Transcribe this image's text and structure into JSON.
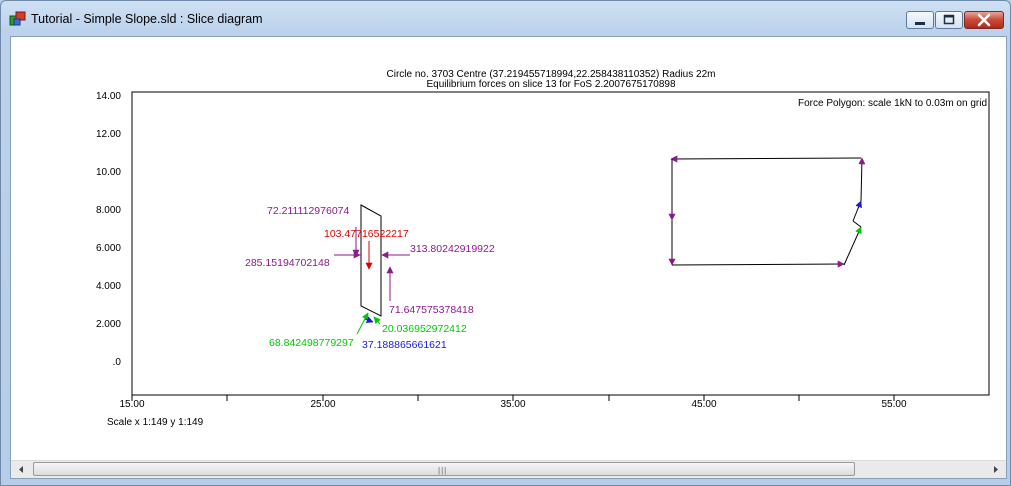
{
  "window": {
    "title": "Tutorial - Simple Slope.sld : Slice diagram",
    "controls": [
      "minimize",
      "maximize",
      "close"
    ]
  },
  "diagram": {
    "heading_line1": "Circle no. 3703 Centre (37.219455718994,22.258438110352) Radius 22m",
    "heading_line2": "Equilibrium forces on slice 13 for FoS 2.2007675170898",
    "polygon_caption": "Force Polygon: scale 1kN to 0.03m on grid",
    "scale_text": "Scale x 1:149  y 1:149",
    "y_ticks": [
      "14.00",
      "12.00",
      "10.00",
      "8.000",
      "6.000",
      "4.000",
      "2.000",
      ".0"
    ],
    "x_ticks": [
      "15.00",
      "25.00",
      "35.00",
      "45.00",
      "55.00"
    ],
    "force_labels": [
      {
        "name": "force-label-72",
        "text": "72.211112976074",
        "color": "#8b1a8b"
      },
      {
        "name": "force-label-103",
        "text": "103.47716522217",
        "color": "#e00000"
      },
      {
        "name": "force-label-285",
        "text": "285.15194702148",
        "color": "#8b1a8b"
      },
      {
        "name": "force-label-313",
        "text": "313.80242919922",
        "color": "#8b1a8b"
      },
      {
        "name": "force-label-71",
        "text": "71.647575378418",
        "color": "#8b1a8b"
      },
      {
        "name": "force-label-20",
        "text": "20.036952972412",
        "color": "#00c800"
      },
      {
        "name": "force-label-68",
        "text": "68.842498779297",
        "color": "#00c800"
      },
      {
        "name": "force-label-37",
        "text": "37.188865661621",
        "color": "#1a1adc"
      }
    ]
  },
  "colors": {
    "purple": "#8b1a8b",
    "red": "#e00000",
    "green": "#00c800",
    "blue": "#1a1adc",
    "close_button": "#c8493a"
  },
  "scrollbar": {
    "grip_icon": "scroll-grip-icon"
  }
}
